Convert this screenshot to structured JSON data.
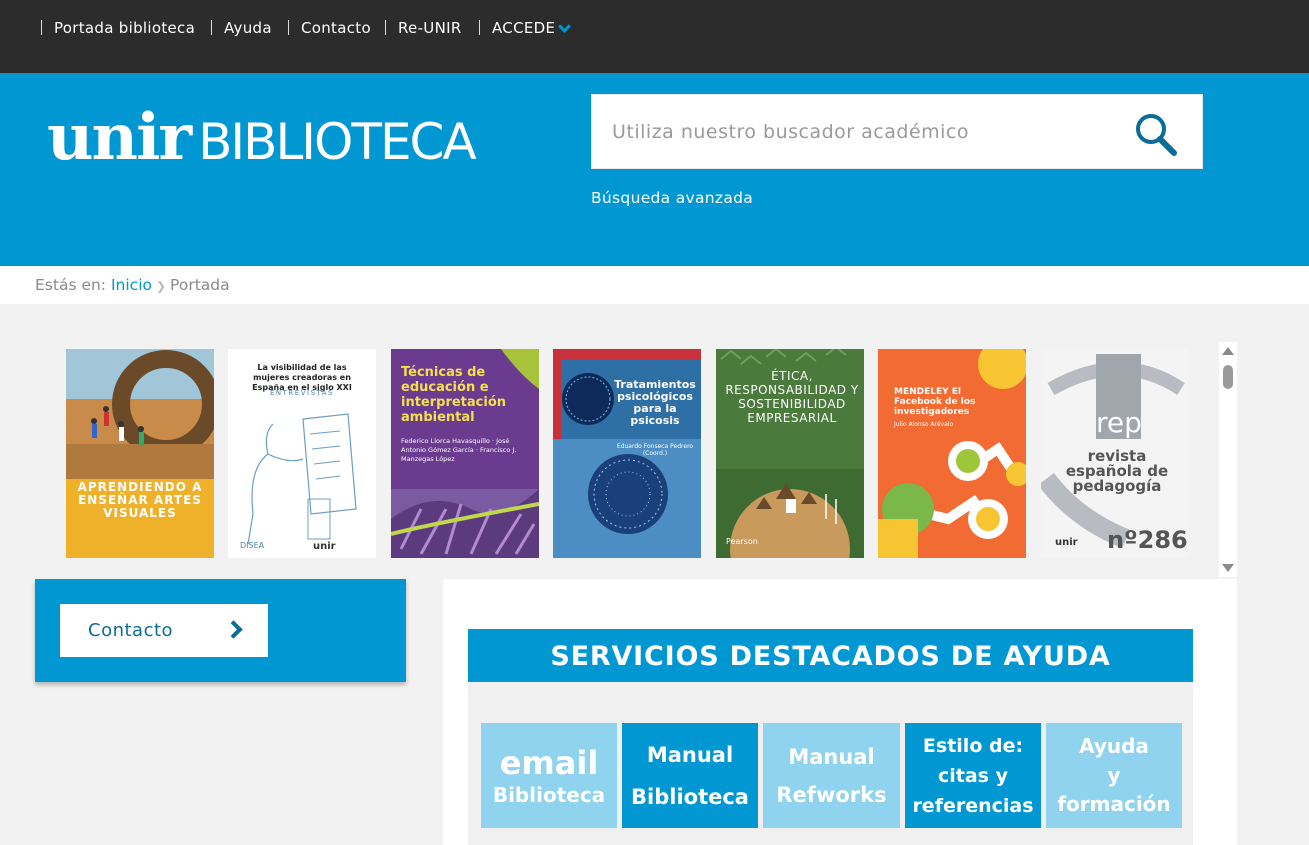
{
  "topnav": {
    "items": [
      {
        "label": "Portada biblioteca"
      },
      {
        "label": "Ayuda"
      },
      {
        "label": "Contacto"
      },
      {
        "label": "Re-UNIR"
      },
      {
        "label": "ACCEDE"
      }
    ]
  },
  "header": {
    "logo_brand": "unir",
    "logo_text": "BIBLIOTECA",
    "search_placeholder": "Utiliza nuestro buscador académico",
    "advanced_search": "Búsqueda avanzada"
  },
  "breadcrumb": {
    "prefix": "Estás en:",
    "home": "Inicio",
    "current": "Portada"
  },
  "books": [
    {
      "title": "APRENDIENDO A ENSEÑAR ARTES VISUALES",
      "bg": "#e8a43a"
    },
    {
      "title": "La visibilidad de las mujeres creadoras en España en el siglo XXI",
      "subtitle": "ENTREVISTAS",
      "bg": "#ffffff"
    },
    {
      "title": "Técnicas de educación e interpretación ambiental",
      "authors": "Federico Llorca Havasquillo · José Antonio Gómez García · Francisco J. Manzegas López",
      "bg": "#6a3b8e"
    },
    {
      "title": "Tratamientos psicológicos para la psicosis",
      "authors": "Eduardo Fonseca Pedrero (Coord.)",
      "bg": "#2d6f9e"
    },
    {
      "title": "ÉTICA, RESPONSABILIDAD Y SOSTENIBILIDAD EMPRESARIAL",
      "publisher": "Pearson",
      "bg": "#3d6b32"
    },
    {
      "title": "MENDELEY El Facebook de los investigadores",
      "authors": "Julio Alonso Arévalo",
      "bg": "#ef5a2f"
    },
    {
      "title": "revista española de pedagogía",
      "issue": "nº286",
      "abbr": "rep",
      "bg": "#f4f4f4"
    }
  ],
  "contact": {
    "label": "Contacto"
  },
  "services": {
    "title": "SERVICIOS DESTACADOS DE AYUDA",
    "items": [
      {
        "line1": "email",
        "line2": "Biblioteca",
        "color": "#8fd3ee"
      },
      {
        "line1": "Manual",
        "line2": "Biblioteca",
        "color": "#0097d3"
      },
      {
        "line1": "Manual",
        "line2": "Refworks",
        "color": "#8fd3ee"
      },
      {
        "line1": "Estilo de:",
        "line2": "citas y",
        "line3": "referencias",
        "color": "#0097d3"
      },
      {
        "line1": "Ayuda",
        "line2": "y",
        "line3": "formación",
        "color": "#8fd3ee"
      }
    ]
  },
  "colors": {
    "brand_blue": "#0097d3",
    "light_blue": "#8fd3ee",
    "topnav_bg": "#2c2c2c"
  }
}
